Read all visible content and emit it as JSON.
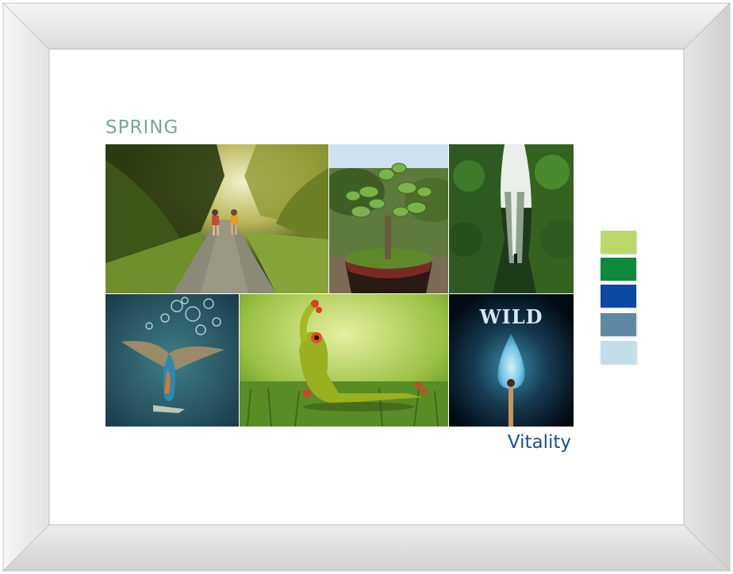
{
  "board": {
    "title": "SPRING",
    "caption": "Vitality"
  },
  "photos": [
    {
      "id": "runners",
      "description_icon": "runners-path-photo"
    },
    {
      "id": "plant",
      "description_icon": "jade-plant-photo"
    },
    {
      "id": "falls",
      "description_icon": "waterfall-photo"
    },
    {
      "id": "bird",
      "description_icon": "kingfisher-dive-photo"
    },
    {
      "id": "frog",
      "description_icon": "frog-figurine-photo"
    },
    {
      "id": "match",
      "description_icon": "match-flame-photo",
      "text": "WILD"
    }
  ],
  "palette": {
    "colors": [
      "#bcd86a",
      "#0e8a3c",
      "#0b47a3",
      "#5f88a4",
      "#c2dfe9"
    ]
  }
}
